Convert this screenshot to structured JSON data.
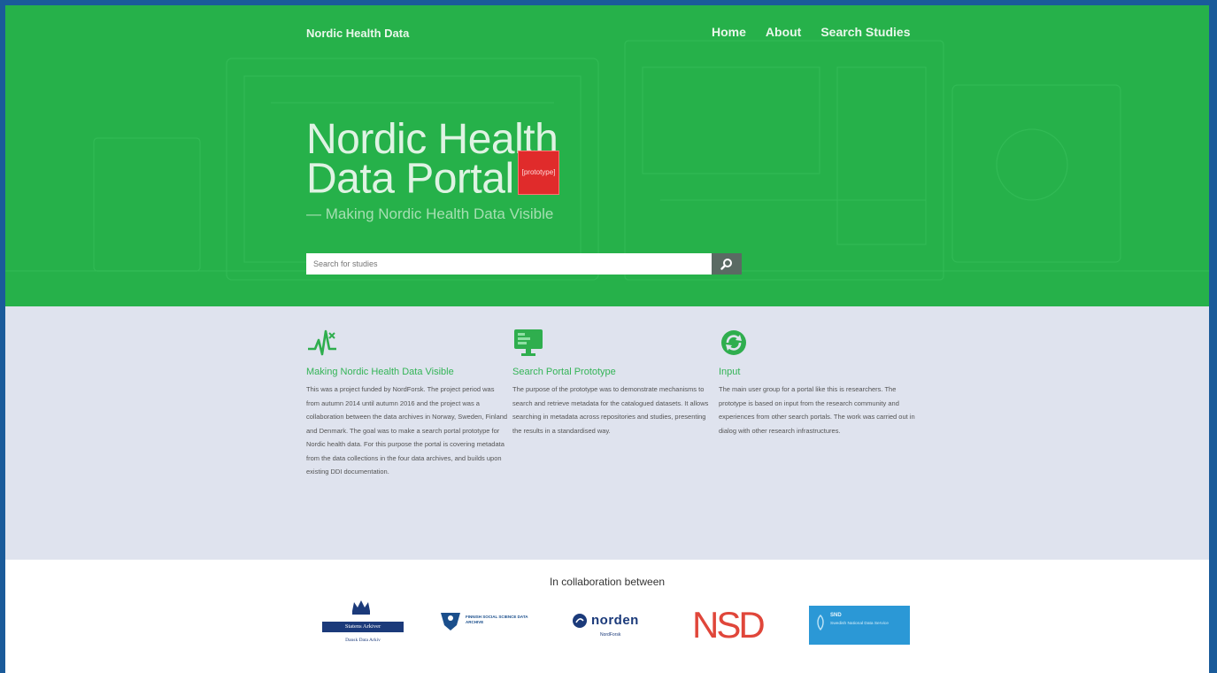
{
  "nav": {
    "brand": "Nordic Health Data",
    "links": [
      "Home",
      "About",
      "Search Studies"
    ]
  },
  "hero": {
    "title_line1": "Nordic Health",
    "title_line2": "Data Portal",
    "badge": "[prototype]",
    "subtitle": "— Making Nordic Health Data Visible",
    "search_placeholder": "Search for studies"
  },
  "features": [
    {
      "icon": "heartbeat-icon",
      "title": "Making Nordic Health Data Visible",
      "text": "This was a project funded by NordForsk. The project period was from autumn 2014 until autumn 2016 and the project was a collaboration between the data archives in Norway, Sweden, Finland and Denmark. The goal was to make a search portal prototype for Nordic health data. For this purpose the portal is covering metadata from the data collections in the four data archives, and builds upon existing DDI documentation."
    },
    {
      "icon": "monitor-icon",
      "title": "Search Portal Prototype",
      "text": "The purpose of the prototype was to demonstrate mechanisms to search and retrieve metadata for the catalogued datasets. It allows searching in metadata across repositories and studies, presenting the results in a standardised way."
    },
    {
      "icon": "refresh-icon",
      "title": "Input",
      "text": "The main user group for a portal like this is researchers. The prototype is based on input from the research community and experiences from other search portals. The work was carried out in dialog with other research infrastructures."
    }
  ],
  "collab": {
    "title": "In collaboration between",
    "logos": {
      "dda_line1": "Statens Arkiver",
      "dda_line2": "Dansk Data Arkiv",
      "fsd": "FINNISH SOCIAL SCIENCE DATA ARCHIVE",
      "norden": "norden",
      "norden_sub": "NordForsk",
      "nsd": "NSD",
      "snd": "SND",
      "snd_sub": "Swedish National Data Service"
    }
  },
  "colors": {
    "hero_green": "#26b14a",
    "feature_green": "#34b457",
    "badge_red": "#e02b2b",
    "frame_blue": "#1a5b9a"
  }
}
